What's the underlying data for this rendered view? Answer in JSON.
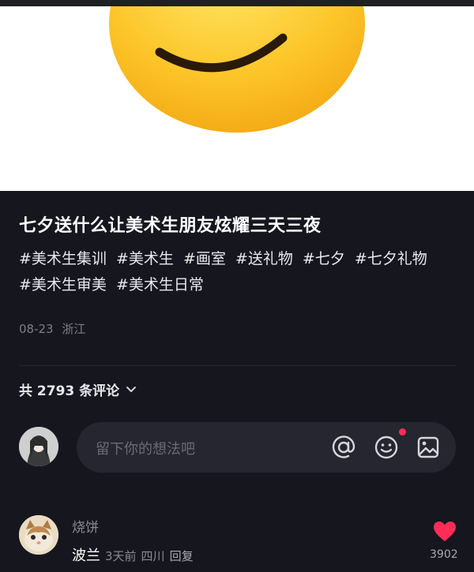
{
  "post": {
    "title": "七夕送什么让美术生朋友炫耀三天三夜",
    "tags": [
      "#美术生集训",
      "#美术生",
      "#画室",
      "#送礼物",
      "#七夕",
      "#七夕礼物",
      "#美术生审美",
      "#美术生日常"
    ],
    "date": "08-23",
    "location": "浙江"
  },
  "comments_header": {
    "count_label": "共 2793 条评论"
  },
  "comment_input": {
    "placeholder": "留下你的想法吧",
    "icons": [
      "at-icon",
      "emoji-icon",
      "image-icon"
    ],
    "notification_color": "#ff2d55"
  },
  "comments": [
    {
      "username": "烧饼",
      "text": "波兰",
      "time": "3天前",
      "location": "四川",
      "reply_label": "回复",
      "likes": "3902",
      "liked": true
    }
  ],
  "colors": {
    "background": "#16161f",
    "like": "#ff2d55",
    "emoji_yellow": "#fbc21d"
  }
}
